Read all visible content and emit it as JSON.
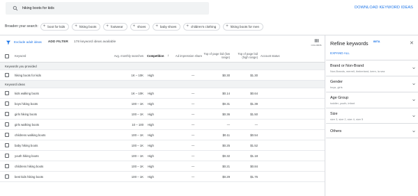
{
  "search": {
    "query": "hiking boots for kids"
  },
  "download_label": "DOWNLOAD KEYWORD IDEAS",
  "broaden": {
    "label": "Broaden your search:",
    "chips": [
      "boot for kids",
      "hiking boots",
      "footwear",
      "shoes",
      "baby shoes",
      "children's clothing",
      "hiking boots for men"
    ]
  },
  "filters": {
    "exclude_label": "Exclude adult ideas",
    "add_filter": "ADD FILTER",
    "available": "178 keyword ideas available",
    "columns_label": "COLUMNS"
  },
  "table": {
    "headers": {
      "keyword": "Keyword",
      "searches": "Avg. monthly searches",
      "competition": "Competition",
      "sort_arrow": "↓",
      "impression_share": "Ad impression share",
      "bid_low": "Top of page bid (low range)",
      "bid_high": "Top of page bid (high range)",
      "account_status": "Account status"
    },
    "provided_section": "Keywords you provided",
    "provided_rows": [
      {
        "keyword": "hiking boots for kids",
        "searches": "1K – 10K",
        "competition": "High",
        "share": "—",
        "low": "$0.30",
        "high": "$1.30"
      }
    ],
    "ideas_section": "Keyword ideas",
    "idea_rows": [
      {
        "keyword": "kids walking boots",
        "searches": "1K – 10K",
        "competition": "High",
        "share": "—",
        "low": "$0.14",
        "high": "$0.64"
      },
      {
        "keyword": "boys hiking boots",
        "searches": "100 – 1K",
        "competition": "High",
        "share": "—",
        "low": "$0.31",
        "high": "$1.39"
      },
      {
        "keyword": "girls hiking boots",
        "searches": "100 – 1K",
        "competition": "High",
        "share": "—",
        "low": "$0.36",
        "high": "$1.50"
      },
      {
        "keyword": "girls walking boots",
        "searches": "10 – 100",
        "competition": "High",
        "share": "—",
        "low": "—",
        "high": "—"
      },
      {
        "keyword": "childrens walking boots",
        "searches": "100 – 1K",
        "competition": "High",
        "share": "—",
        "low": "$0.11",
        "high": "$0.54"
      },
      {
        "keyword": "baby hiking boots",
        "searches": "100 – 1K",
        "competition": "High",
        "share": "—",
        "low": "$0.25",
        "high": "$1.52"
      },
      {
        "keyword": "youth hiking boots",
        "searches": "100 – 1K",
        "competition": "High",
        "share": "—",
        "low": "$0.32",
        "high": "$1.18"
      },
      {
        "keyword": "childrens hiking boots",
        "searches": "100 – 1K",
        "competition": "High",
        "share": "—",
        "low": "$0.21",
        "high": "$0.84"
      },
      {
        "keyword": "best kids hiking boots",
        "searches": "100 – 1K",
        "competition": "High",
        "share": "—",
        "low": "$0.29",
        "high": "$1.76"
      }
    ]
  },
  "refine": {
    "title": "Refine keywords",
    "beta": "BETA",
    "expand_all": "EXPAND ALL",
    "groups": [
      {
        "title": "Brand or Non-Brand",
        "sub": "Non-Brands, merrell, timberland, keen, la sea"
      },
      {
        "title": "Gender",
        "sub": "boys, girls"
      },
      {
        "title": "Age Group",
        "sub": "toddler, youth, infant"
      },
      {
        "title": "Size",
        "sub": "size 3, size 2, size 4, size 5"
      },
      {
        "title": "Others",
        "sub": ""
      }
    ]
  },
  "colors": {
    "accent": "#1a73e8",
    "section_bg": "#f1f3f4",
    "border": "#dadce0"
  }
}
